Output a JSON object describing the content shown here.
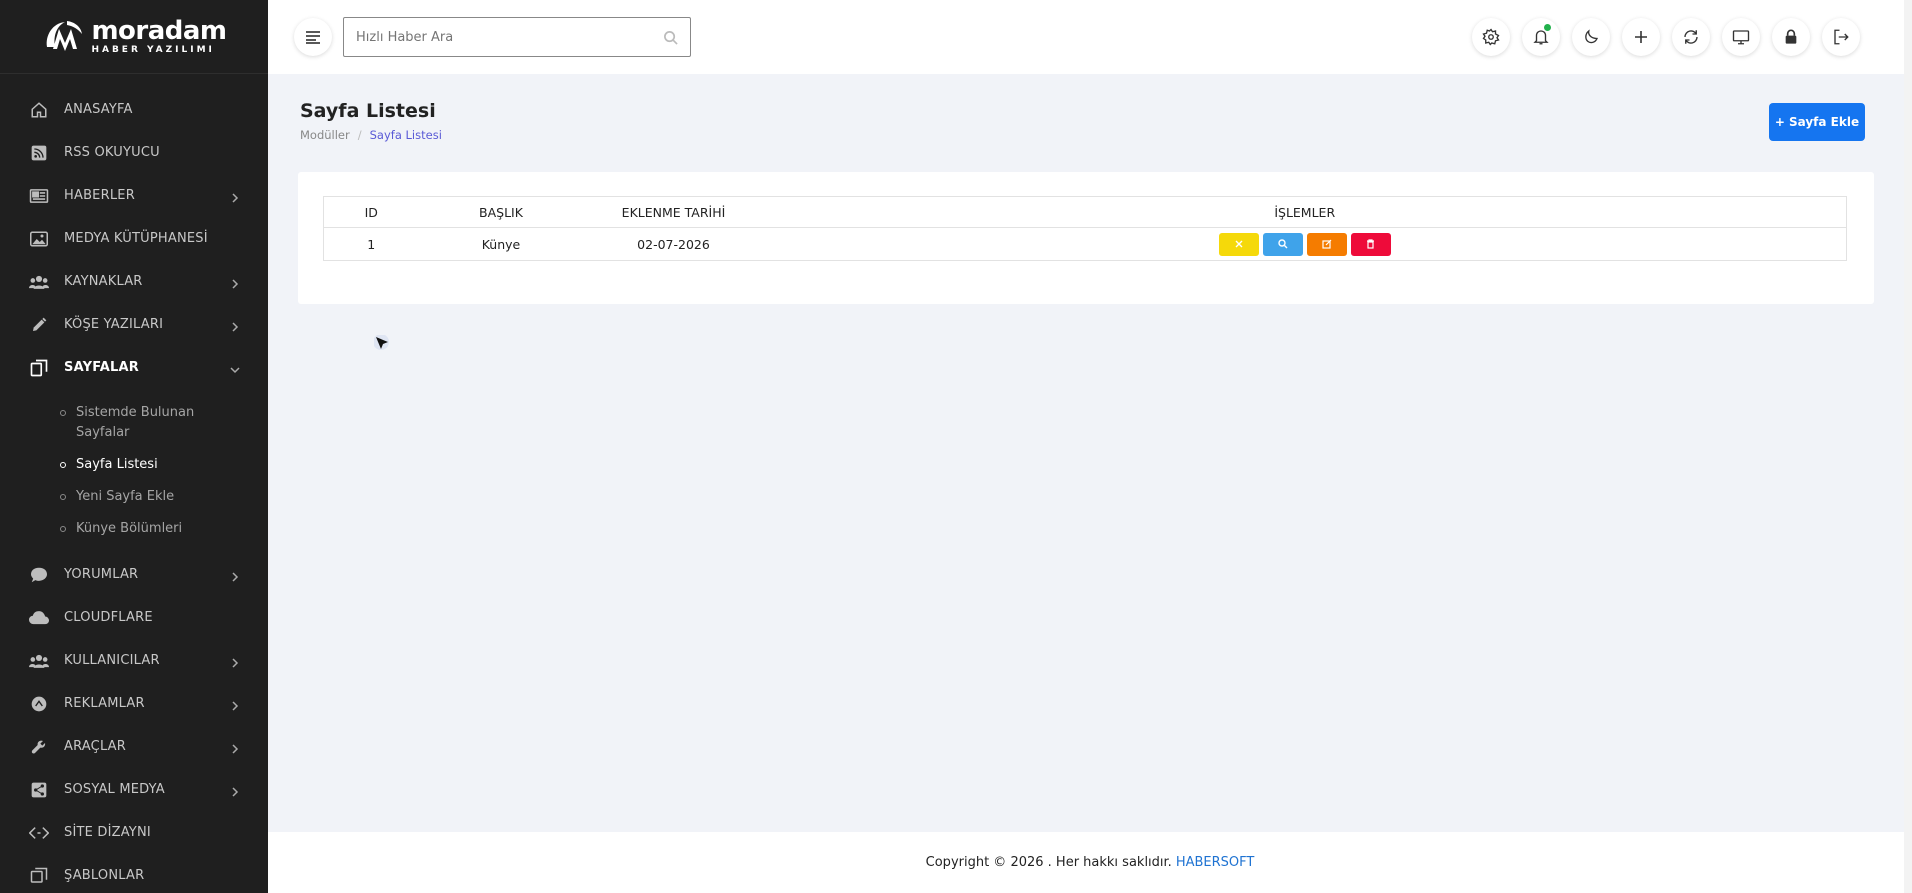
{
  "brand": {
    "name": "moradam",
    "tagline": "HABER YAZILIMI"
  },
  "sidebar": {
    "items": [
      {
        "label": "ANASAYFA",
        "icon": "home-icon",
        "chevron": false
      },
      {
        "label": "RSS OKUYUCU",
        "icon": "rss-icon",
        "chevron": false
      },
      {
        "label": "HABERLER",
        "icon": "newspaper-icon",
        "chevron": true
      },
      {
        "label": "MEDYA KÜTÜPHANESİ",
        "icon": "image-icon",
        "chevron": false
      },
      {
        "label": "KAYNAKLAR",
        "icon": "users-icon",
        "chevron": true
      },
      {
        "label": "KÖŞE YAZILARI",
        "icon": "pen-icon",
        "chevron": true
      },
      {
        "label": "SAYFALAR",
        "icon": "pages-icon",
        "chevron": true,
        "active": true
      },
      {
        "label": "YORUMLAR",
        "icon": "comment-icon",
        "chevron": true
      },
      {
        "label": "CLOUDFLARE",
        "icon": "cloud-icon",
        "chevron": false
      },
      {
        "label": "KULLANICILAR",
        "icon": "users-icon",
        "chevron": true
      },
      {
        "label": "REKLAMLAR",
        "icon": "ad-icon",
        "chevron": true
      },
      {
        "label": "ARAÇLAR",
        "icon": "wrench-icon",
        "chevron": true
      },
      {
        "label": "SOSYAL MEDYA",
        "icon": "share-icon",
        "chevron": true
      },
      {
        "label": "SİTE DİZAYNI",
        "icon": "code-icon",
        "chevron": false
      },
      {
        "label": "ŞABLONLAR",
        "icon": "template-icon",
        "chevron": false
      }
    ],
    "submenu": [
      {
        "label": "Sistemde Bulunan Sayfalar",
        "active": false
      },
      {
        "label": "Sayfa Listesi",
        "active": true
      },
      {
        "label": "Yeni Sayfa Ekle",
        "active": false
      },
      {
        "label": "Künye Bölümleri",
        "active": false
      }
    ]
  },
  "topbar": {
    "search_placeholder": "Hızlı Haber Ara",
    "icons": [
      "settings-icon",
      "bell-icon",
      "moon-icon",
      "plus-icon",
      "refresh-icon",
      "monitor-icon",
      "lock-icon",
      "logout-icon"
    ]
  },
  "main": {
    "title": "Sayfa Listesi",
    "breadcrumb": [
      "Modüller",
      "Sayfa Listesi"
    ],
    "add_button": "Sayfa Ekle",
    "table": {
      "headers": [
        "ID",
        "BAŞLIK",
        "EKLENME TARİHİ",
        "İŞLEMLER"
      ],
      "rows": [
        {
          "id": "1",
          "title": "Künye",
          "date": "02-07-2026"
        }
      ]
    },
    "action_colors": {
      "close": "#f5d90a",
      "view": "#3fa3ea",
      "edit": "#f57c00",
      "delete": "#ee0b3a"
    }
  },
  "footer": {
    "text": "Copyright © 2026 . Her hakkı saklıdır.",
    "brand": "HABERSOFT"
  }
}
